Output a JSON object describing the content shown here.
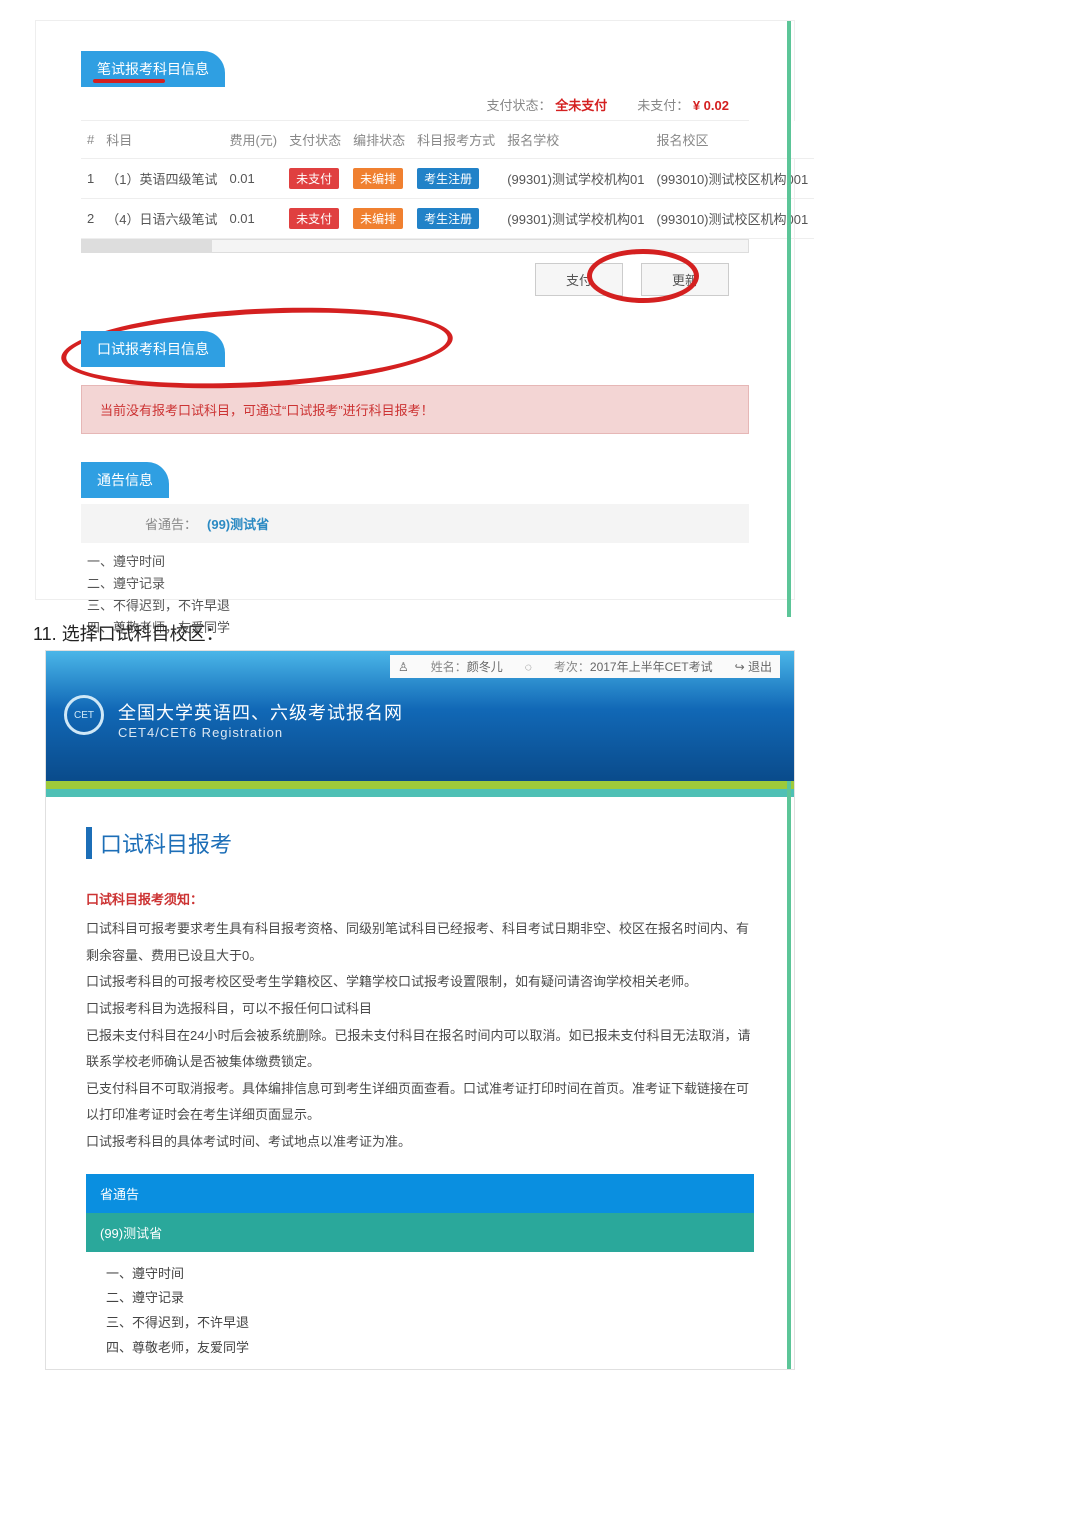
{
  "upper_panel": {
    "written_section_title": "笔试报考科目信息",
    "pay_status_label": "支付状态：",
    "pay_status_value": "全未支付",
    "unpaid_label": "未支付：",
    "unpaid_value": "¥ 0.02",
    "columns": {
      "idx": "#",
      "subject": "科目",
      "fee": "费用(元)",
      "pay": "支付状态",
      "arrange": "编排状态",
      "regway": "科目报考方式",
      "school": "报名学校",
      "campus": "报名校区"
    },
    "scroll_handle": "…",
    "rows": [
      {
        "idx": "1",
        "subject": "（1）英语四级笔试",
        "fee": "0.01",
        "pay_badge": "未支付",
        "arrange_badge": "未编排",
        "regway_badge": "考生注册",
        "school": "(99301)测试学校机构01",
        "campus": "(993010)测试校区机构001"
      },
      {
        "idx": "2",
        "subject": "（4）日语六级笔试",
        "fee": "0.01",
        "pay_badge": "未支付",
        "arrange_badge": "未编排",
        "regway_badge": "考生注册",
        "school": "(99301)测试学校机构01",
        "campus": "(993010)测试校区机构001"
      }
    ],
    "pay_btn": "支付",
    "refresh_btn": "更新",
    "oral_section_title": "口试报考科目信息",
    "oral_alert": "当前没有报考口试科目，可通过“口试报考”进行科目报考！",
    "notice_section_title": "通告信息",
    "provincial_notice_label": "省通告：",
    "provincial_notice_value": "(99)测试省",
    "rules": [
      "一、遵守时间",
      "二、遵守记录",
      "三、不得迟到，不许早退",
      "四、尊敬老师，友爱同学"
    ]
  },
  "step_text": "11. 选择口试科目校区：",
  "lower_panel": {
    "top_bar": {
      "name_label": "姓名：",
      "name_value": "颜冬儿",
      "exam_label": "考次：",
      "exam_value": "2017年上半年CET考试",
      "logout": "退出"
    },
    "banner_cn": "全国大学英语四、六级考试报名网",
    "banner_en": "CET4/CET6  Registration",
    "page_title": "口试科目报考",
    "instructions_head": "口试科目报考须知：",
    "instr_p1": "口试科目可报考要求考生具有科目报考资格、同级别笔试科目已经报考、科目考试日期非空、校区在报名时间内、有剩余容量、费用已设且大于0。",
    "instr_p2": "口试报考科目的可报考校区受考生学籍校区、学籍学校口试报考设置限制，如有疑问请咨询学校相关老师。",
    "instr_p3": "口试报考科目为选报科目，可以不报任何口试科目",
    "instr_p4": "已报未支付科目在24小时后会被系统删除。已报未支付科目在报名时间内可以取消。如已报未支付科目无法取消，请联系学校老师确认是否被集体缴费锁定。",
    "instr_p5": "已支付科目不可取消报考。具体编排信息可到考生详细页面查看。口试准考证打印时间在首页。准考证下载链接在可以打印准考证时会在考生详细页面显示。",
    "instr_p6": "口试报考科目的具体考试时间、考试地点以准考证为准。",
    "prov_notice_title": "省通告",
    "prov_sub_title": "(99)测试省",
    "rules": [
      "一、遵守时间",
      "二、遵守记录",
      "三、不得迟到，不许早退",
      "四、尊敬老师，友爱同学"
    ]
  }
}
